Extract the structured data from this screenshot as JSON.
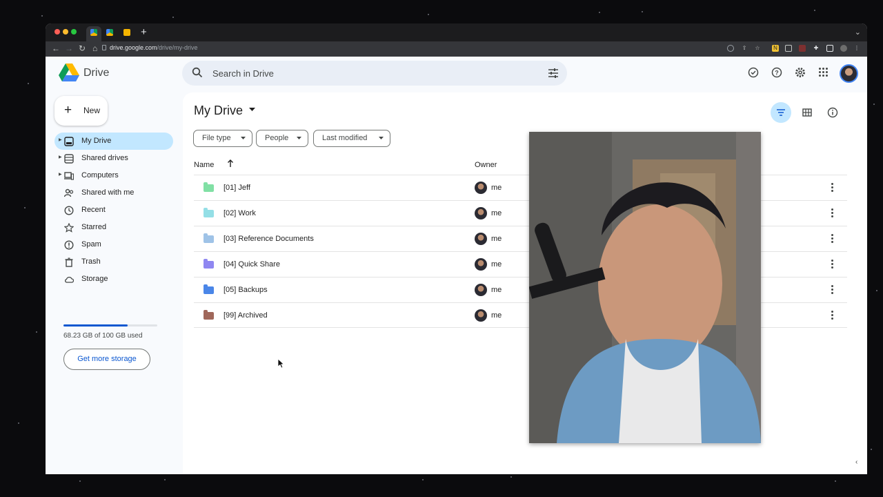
{
  "browser": {
    "url_host": "drive.google.com",
    "url_path": "/drive/my-drive",
    "new_tab": "+"
  },
  "app": {
    "name": "Drive",
    "search_placeholder": "Search in Drive"
  },
  "sidebar": {
    "new_label": "New",
    "items": [
      {
        "label": "My Drive",
        "icon": "my-drive-icon",
        "active": true,
        "expandable": true
      },
      {
        "label": "Shared drives",
        "icon": "shared-drives-icon",
        "active": false,
        "expandable": true
      },
      {
        "label": "Computers",
        "icon": "computers-icon",
        "active": false,
        "expandable": true
      },
      {
        "label": "Shared with me",
        "icon": "shared-with-me-icon",
        "active": false,
        "expandable": false
      },
      {
        "label": "Recent",
        "icon": "clock-icon",
        "active": false,
        "expandable": false
      },
      {
        "label": "Starred",
        "icon": "star-icon",
        "active": false,
        "expandable": false
      },
      {
        "label": "Spam",
        "icon": "spam-icon",
        "active": false,
        "expandable": false
      },
      {
        "label": "Trash",
        "icon": "trash-icon",
        "active": false,
        "expandable": false
      },
      {
        "label": "Storage",
        "icon": "cloud-icon",
        "active": false,
        "expandable": false
      }
    ],
    "storage_text": "68.23 GB of 100 GB used",
    "storage_fraction": 0.6823,
    "more_storage": "Get more storage"
  },
  "main": {
    "title": "My Drive",
    "filters": [
      "File type",
      "People",
      "Last modified"
    ],
    "col_name": "Name",
    "col_owner": "Owner",
    "rows": [
      {
        "name": "[01] Jeff",
        "owner": "me",
        "color": "#81e0a5"
      },
      {
        "name": "[02] Work",
        "owner": "me",
        "color": "#94dfe6"
      },
      {
        "name": "[03] Reference Documents",
        "owner": "me",
        "color": "#9fc3e7"
      },
      {
        "name": "[04] Quick Share",
        "owner": "me",
        "color": "#8f87f1"
      },
      {
        "name": "[05] Backups",
        "owner": "me",
        "color": "#4a86e8"
      },
      {
        "name": "[99] Archived",
        "owner": "me",
        "color": "#a0675a"
      }
    ]
  },
  "colors": {
    "accent": "#0b57d0",
    "active_nav": "#c2e7ff",
    "search_bg": "#e9eef6"
  }
}
